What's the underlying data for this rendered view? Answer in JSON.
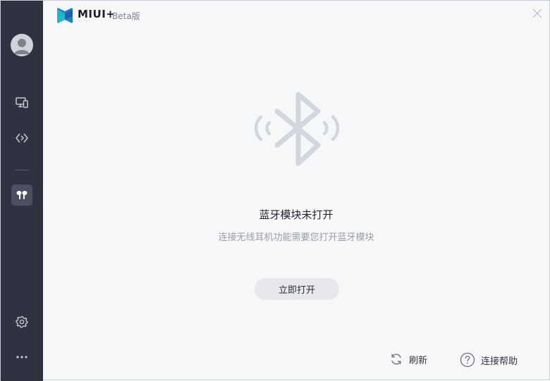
{
  "app": {
    "brand": "MIUI+",
    "edition": "Beta版"
  },
  "sidebar": {
    "items": [
      {
        "icon": "user-avatar-icon"
      },
      {
        "icon": "devices-icon"
      },
      {
        "icon": "connect-icon"
      },
      {
        "icon": "earbuds-icon",
        "active": true
      },
      {
        "icon": "gear-icon"
      },
      {
        "icon": "more-icon"
      }
    ]
  },
  "main": {
    "illustration_icon": "bluetooth-icon",
    "title": "蓝牙模块未打开",
    "subtitle": "连接无线耳机功能需要您打开蓝牙模块",
    "open_button_label": "立即打开"
  },
  "footer": {
    "refresh_label": "刷新",
    "help_label": "连接帮助"
  },
  "colors": {
    "sidebar_bg": "#2e3241",
    "content_bg": "#f6f7f9",
    "illustration": "#d2d6de",
    "logo_primary": "#1f7fc9",
    "logo_accent": "#20b8c8"
  }
}
